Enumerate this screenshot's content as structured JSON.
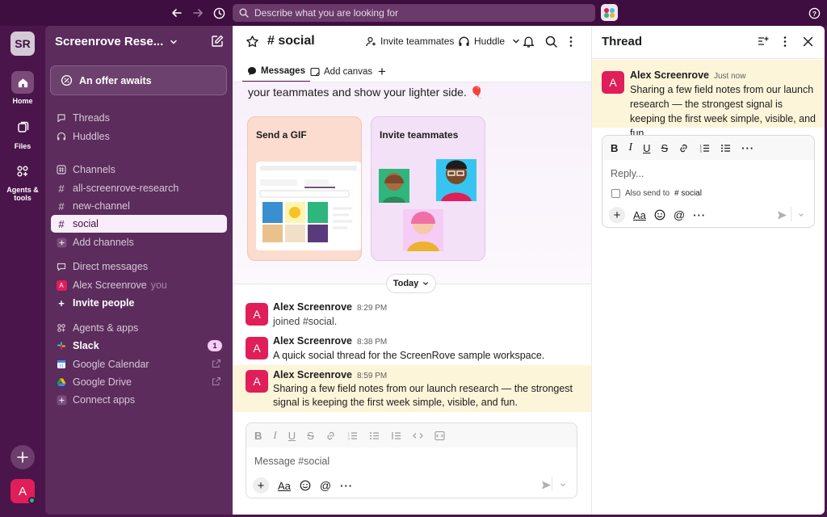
{
  "search": {
    "placeholder": "Describe what you are looking for"
  },
  "rail": {
    "workspace_initials": "SR",
    "home_label": "Home",
    "files_label": "Files",
    "agents_label": "Agents & tools",
    "user_initial": "A"
  },
  "sidebar": {
    "workspace_name": "Screenrove Rese...",
    "offer_label": "An offer awaits",
    "threads": "Threads",
    "huddles": "Huddles",
    "channels_header": "Channels",
    "channels": [
      "all-screenrove-research",
      "new-channel",
      "social"
    ],
    "add_channels": "Add channels",
    "dm_header": "Direct messages",
    "dm_user": "Alex Screenrove",
    "dm_you": "you",
    "invite_people": "Invite people",
    "apps_header": "Agents & apps",
    "apps": [
      {
        "name": "Slack",
        "badge": "1"
      },
      {
        "name": "Google Calendar"
      },
      {
        "name": "Google Drive"
      }
    ],
    "connect_apps": "Connect apps"
  },
  "channel": {
    "name": "# social",
    "invite_teammates": "Invite teammates",
    "huddle": "Huddle",
    "tabs": [
      "Messages",
      "Add canvas"
    ],
    "intro_text": "your teammates and show your lighter side. 🎈",
    "card_gif": "Send a GIF",
    "card_invite": "Invite teammates",
    "date_divider": "Today",
    "messages": [
      {
        "author": "Alex Screenrove",
        "time": "8:29 PM",
        "text": "joined #social."
      },
      {
        "author": "Alex Screenrove",
        "time": "8:38 PM",
        "text": "A quick social thread for the ScreenRove sample workspace."
      },
      {
        "author": "Alex Screenrove",
        "time": "8:59 PM",
        "text": "Sharing a few field notes from our launch research — the strongest signal is keeping the first week simple, visible, and fun."
      }
    ],
    "composer_placeholder": "Message #social"
  },
  "thread": {
    "title": "Thread",
    "author": "Alex Screenrove",
    "time": "Just now",
    "text": "Sharing a few field notes from our launch research — the strongest signal is keeping the first week simple, visible, and fun.",
    "reply_placeholder": "Reply...",
    "also_send_to": "Also send to",
    "also_send_channel": "# social"
  },
  "colors": {
    "brand": "#4a154b",
    "sidebar": "#5b2c5c",
    "avatar": "#e01e5a",
    "highlight": "#fdf5d9",
    "badge": "#f4ccf5"
  }
}
